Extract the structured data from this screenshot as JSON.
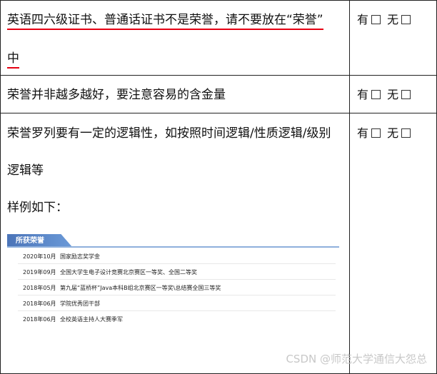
{
  "rows": [
    {
      "text_line1": "英语四六级证书、普通话证书不是荣誉，请不要放在“荣誉”",
      "text_line2": "中",
      "choice": {
        "yes": "有",
        "no": "无"
      }
    },
    {
      "text_line1": "荣誉并非越多越好，要注意容易的含金量",
      "choice": {
        "yes": "有",
        "no": "无"
      }
    },
    {
      "text_line1": "荣誉罗列要有一定的逻辑性，如按照时间逻辑/性质逻辑/级别",
      "text_line2": "逻辑等",
      "text_line3": "样例如下：",
      "choice": {
        "yes": "有",
        "no": "无"
      }
    }
  ],
  "sample": {
    "header": "所获荣誉",
    "items": [
      {
        "date": "2020年10月",
        "text": "国家励志奖学金"
      },
      {
        "date": "2019年09月",
        "text": "全国大学生电子设计竞赛北京赛区一等奖、全国二等奖"
      },
      {
        "date": "2018年05月",
        "text": "第九届“蓝桥杯”Java本科B组北京赛区一等奖\\总结赛全国三等奖"
      },
      {
        "date": "2018年06月",
        "text": "学院优秀团干部"
      },
      {
        "date": "2018年06月",
        "text": "全校英语主持人大赛季军"
      }
    ]
  },
  "watermark": "CSDN @师范大学通信大怨总"
}
